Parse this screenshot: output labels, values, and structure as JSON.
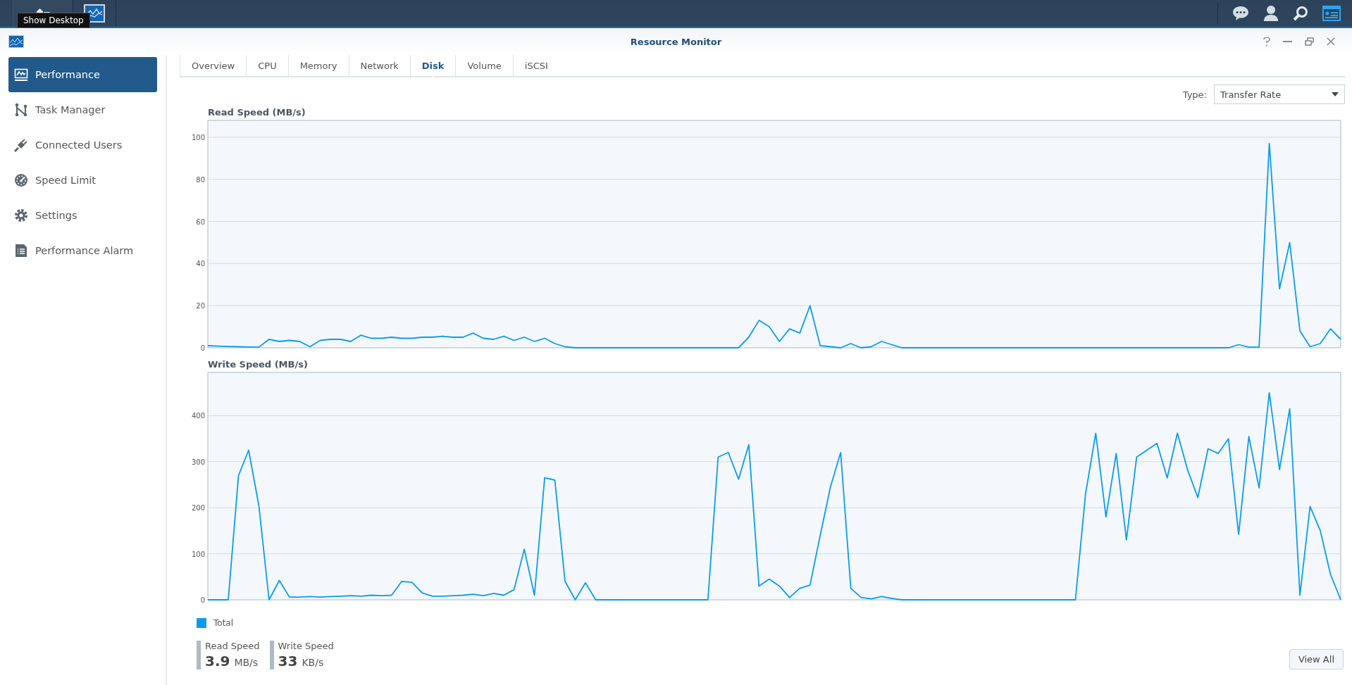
{
  "taskbar": {
    "tooltip": "Show Desktop"
  },
  "window": {
    "title": "Resource Monitor"
  },
  "sidebar": {
    "items": [
      {
        "label": "Performance",
        "selected": true
      },
      {
        "label": "Task Manager",
        "selected": false
      },
      {
        "label": "Connected Users",
        "selected": false
      },
      {
        "label": "Speed Limit",
        "selected": false
      },
      {
        "label": "Settings",
        "selected": false
      },
      {
        "label": "Performance Alarm",
        "selected": false
      }
    ]
  },
  "tabs": [
    {
      "label": "Overview",
      "selected": false
    },
    {
      "label": "CPU",
      "selected": false
    },
    {
      "label": "Memory",
      "selected": false
    },
    {
      "label": "Network",
      "selected": false
    },
    {
      "label": "Disk",
      "selected": true
    },
    {
      "label": "Volume",
      "selected": false
    },
    {
      "label": "iSCSI",
      "selected": false
    }
  ],
  "type_select": {
    "label": "Type:",
    "value": "Transfer Rate"
  },
  "charts": [
    {
      "chart_data": {
        "type": "line",
        "title": "Read Speed (MB/s)",
        "grid": true,
        "ylim": [
          0,
          108
        ],
        "yticks": [
          0,
          20,
          40,
          60,
          80,
          100
        ],
        "series": [
          {
            "color": "#0a9bf0",
            "values": [
              1,
              0.8,
              0.6,
              0.5,
              0.4,
              0.3,
              4,
              3,
              3.5,
              3,
              0.5,
              3.5,
              4,
              4,
              3,
              6,
              4.5,
              4.5,
              5,
              4.5,
              4.5,
              5,
              5,
              5.5,
              5,
              5,
              7,
              4.5,
              4,
              5.5,
              3.5,
              5,
              3,
              4.5,
              2,
              0.5,
              0,
              0,
              0,
              0,
              0,
              0,
              0,
              0,
              0,
              0,
              0,
              0,
              0,
              0,
              0,
              0,
              0,
              5,
              13,
              10,
              3,
              9,
              7,
              20,
              1,
              0.5,
              0,
              2,
              0,
              0.5,
              3,
              1.5,
              0,
              0,
              0,
              0,
              0,
              0,
              0,
              0,
              0,
              0,
              0,
              0,
              0,
              0,
              0,
              0,
              0,
              0,
              0,
              0,
              0,
              0,
              0,
              0,
              0,
              0,
              0,
              0,
              0,
              0,
              0,
              0,
              0,
              1.5,
              0.3,
              0.3,
              97,
              28,
              50,
              8,
              0.5,
              2,
              9,
              4
            ]
          }
        ]
      }
    },
    {
      "chart_data": {
        "type": "line",
        "title": "Write Speed (MB/s)",
        "grid": true,
        "ylim": [
          0,
          494
        ],
        "yticks": [
          0,
          100,
          200,
          300,
          400
        ],
        "series": [
          {
            "color": "#0a9bf0",
            "values": [
              0,
              0,
              0,
              270,
              325,
              205,
              0,
              42,
              6,
              6,
              7,
              6,
              7,
              8,
              9,
              8,
              10,
              9,
              10,
              40,
              38,
              15,
              8,
              8,
              9,
              10,
              12,
              9,
              14,
              10,
              22,
              110,
              10,
              265,
              260,
              40,
              0,
              37,
              0,
              0,
              0,
              0,
              0,
              0,
              0,
              0,
              0,
              0,
              0,
              0,
              310,
              320,
              262,
              337,
              30,
              45,
              30,
              5,
              25,
              32,
              140,
              245,
              320,
              25,
              5,
              2,
              7,
              3,
              0,
              0,
              0,
              0,
              0,
              0,
              0,
              0,
              0,
              0,
              0,
              0,
              0,
              0,
              0,
              0,
              0,
              0,
              230,
              362,
              180,
              318,
              130,
              310,
              325,
              340,
              265,
              362,
              282,
              222,
              328,
              318,
              350,
              142,
              355,
              243,
              450,
              283,
              415,
              10,
              203,
              150,
              55,
              0
            ]
          }
        ]
      }
    }
  ],
  "legend": [
    {
      "label": "Total",
      "color": "#0a9bf0"
    }
  ],
  "summary": [
    {
      "label": "Read Speed",
      "value": "3.9",
      "unit": "MB/s"
    },
    {
      "label": "Write Speed",
      "value": "33",
      "unit": "KB/s"
    }
  ],
  "view_all_button": "View All"
}
